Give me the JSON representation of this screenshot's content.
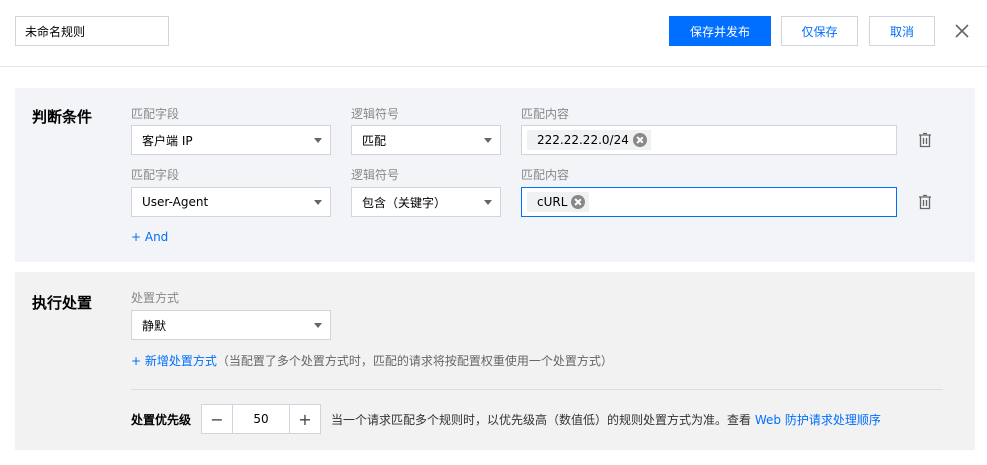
{
  "header": {
    "rule_name_value": "未命名规则",
    "save_publish_label": "保存并发布",
    "save_only_label": "仅保存",
    "cancel_label": "取消"
  },
  "conditions": {
    "title": "判断条件",
    "rows": [
      {
        "field_label": "匹配字段",
        "field_value": "客户端 IP",
        "operator_label": "逻辑符号",
        "operator_value": "匹配",
        "content_label": "匹配内容",
        "tag": "222.22.22.0/24"
      },
      {
        "field_label": "匹配字段",
        "field_value": "User-Agent",
        "operator_label": "逻辑符号",
        "operator_value": "包含（关键字）",
        "content_label": "匹配内容",
        "tag": "cURL"
      }
    ],
    "add_label": "+ And"
  },
  "action": {
    "title": "执行处置",
    "method_label": "处置方式",
    "method_value": "静默",
    "add_method_label": "+ 新增处置方式",
    "add_method_hint": "（当配置了多个处置方式时，匹配的请求将按配置权重使用一个处置方式）",
    "priority_label": "处置优先级",
    "priority_value": "50",
    "priority_hint": "当一个请求匹配多个规则时，以优先级高（数值低）的规则处置方式为准。查看",
    "priority_link": "Web 防护请求处理顺序"
  },
  "colors": {
    "primary": "#006eff",
    "condition_bg": "#f2f4f8",
    "action_bg": "#f2f2f2"
  }
}
